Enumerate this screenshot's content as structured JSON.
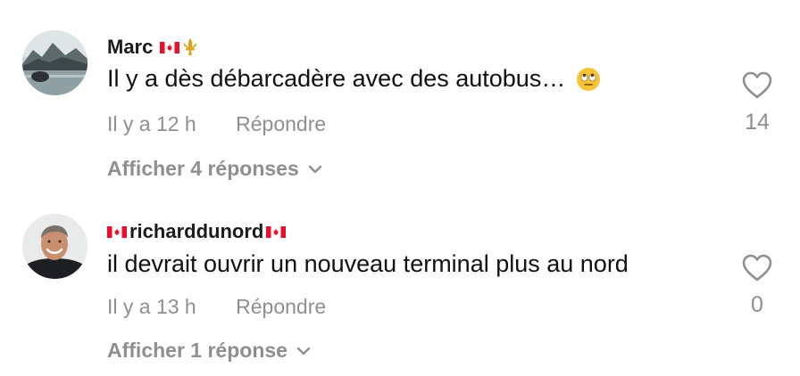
{
  "comments": [
    {
      "username": "Marc",
      "text": "Il y a dès débarcadère avec des autobus…",
      "time": "Il y a 12 h",
      "reply_label": "Répondre",
      "replies_label": "Afficher 4 réponses",
      "likes": "14",
      "avatar_icon": "mountain-lake-avatar",
      "badge_icons": [
        "canada-flag-icon",
        "fleur-de-lis-icon"
      ],
      "emoji_icon": "eye-roll-emoji-icon"
    },
    {
      "username": "richarddunord",
      "text": "il devrait ouvrir un nouveau terminal plus au nord",
      "time": "Il y a 13 h",
      "reply_label": "Répondre",
      "replies_label": "Afficher 1 réponse",
      "likes": "0",
      "avatar_icon": "person-photo-avatar",
      "badge_icons": [
        "canada-flag-icon",
        "canada-flag-icon"
      ]
    }
  ],
  "colors": {
    "text": "#111111",
    "muted": "#8f8f8f",
    "flag_red": "#e8112d"
  }
}
